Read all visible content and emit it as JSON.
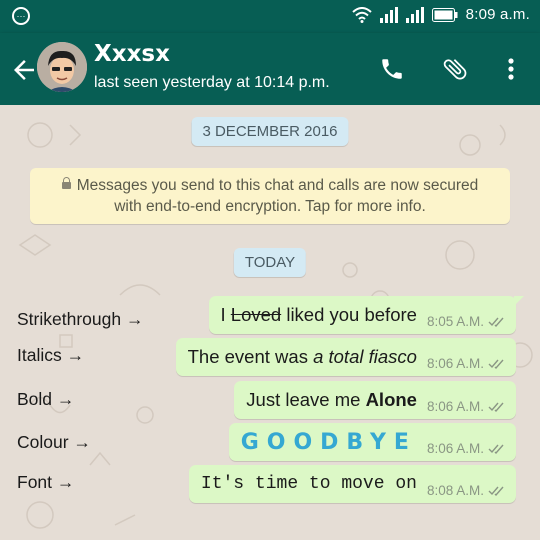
{
  "statusbar": {
    "time": "8:09 a.m.",
    "icons": [
      "notification-icon",
      "wifi-icon",
      "signal-icon",
      "signal-icon",
      "battery-icon"
    ]
  },
  "header": {
    "contact_name": "Xxxsx",
    "last_seen": "last seen yesterday at 10:14 p.m.",
    "actions": [
      "call-icon",
      "attach-icon",
      "more-icon"
    ]
  },
  "chat": {
    "date_chip": "3 DECEMBER 2016",
    "encryption_notice": "Messages you send to this chat and calls are now secured with end-to-end encryption. Tap for more info.",
    "today_chip": "TODAY",
    "messages": [
      {
        "label": "Strikethrough →",
        "parts": {
          "a": "I ",
          "strike": "Loved",
          "b": " liked you before"
        },
        "time": "8:05 A.M."
      },
      {
        "label": "Italics →",
        "parts": {
          "a": "The event was ",
          "em": "a total fiasco"
        },
        "time": "8:06 A.M."
      },
      {
        "label": "Bold →",
        "parts": {
          "a": "Just leave me ",
          "strong": "Alone"
        },
        "time": "8:06 A.M."
      },
      {
        "label": "Colour →",
        "text": "GOODBYE",
        "color": "#35a8d2",
        "time": "8:06 A.M."
      },
      {
        "label": "Font →",
        "text": "It's time to move on",
        "time": "8:08 A.M."
      }
    ]
  },
  "colors": {
    "brand": "#075e54",
    "outgoing_bubble": "#dcf8c6",
    "chat_background": "#e5ddd5",
    "read_tick": "#8a9684"
  }
}
